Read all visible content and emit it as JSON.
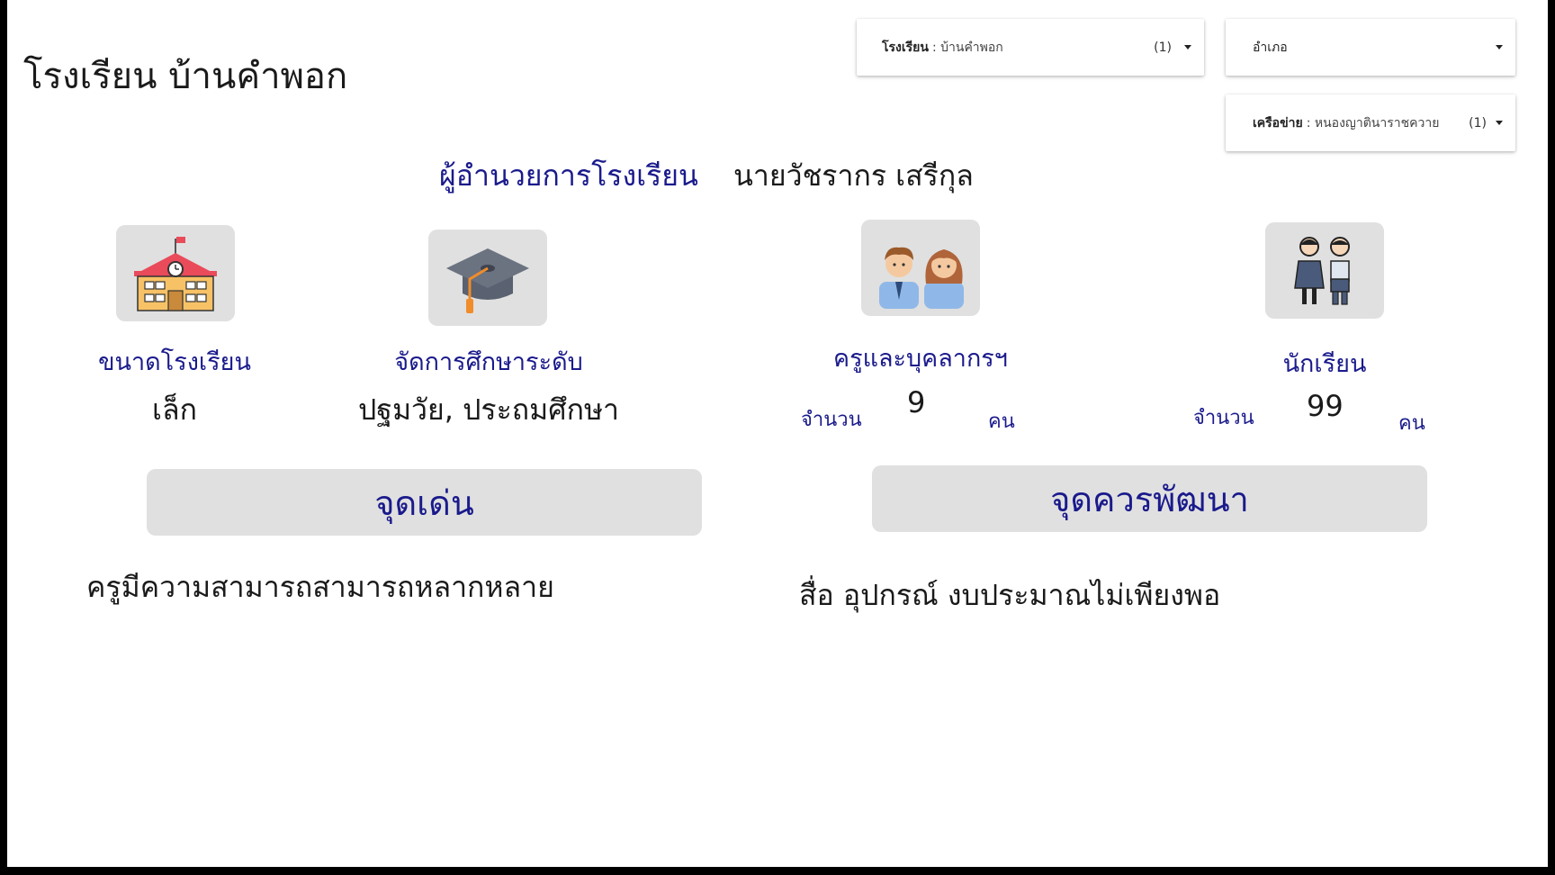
{
  "page": {
    "title": "โรงเรียน บ้านคำพอก"
  },
  "filters": {
    "school": {
      "label": "โรงเรียน",
      "value": ": บ้านคำพอก",
      "count": "(1)"
    },
    "district": {
      "label": "อำเภอ"
    },
    "network": {
      "label": "เครือข่าย",
      "value": ": หนองญาตินาราชควาย",
      "count": "(1)"
    }
  },
  "director": {
    "label": "ผู้อำนวยการโรงเรียน",
    "name": "นายวัชรากร เสรีกุล"
  },
  "stats": {
    "size": {
      "icon": "school-building-icon",
      "label": "ขนาดโรงเรียน",
      "value": "เล็ก"
    },
    "level": {
      "icon": "graduation-cap-icon",
      "label": "จัดการศึกษาระดับ",
      "value": "ปฐมวัย, ประถมศึกษา"
    },
    "staff": {
      "icon": "teachers-icon",
      "label": "ครูและบุคลากรฯ",
      "prefix": "จำนวน",
      "count": "9",
      "unit": "คน"
    },
    "students": {
      "icon": "students-icon",
      "label": "นักเรียน",
      "prefix": "จำนวน",
      "count": "99",
      "unit": "คน"
    }
  },
  "strengths": {
    "header": "จุดเด่น",
    "text": "ครูมีความสามารถสามารถหลากหลาย"
  },
  "improvements": {
    "header": "จุดควรพัฒนา",
    "text": "สื่อ อุปกรณ์ งบประมาณไม่เพียงพอ"
  }
}
